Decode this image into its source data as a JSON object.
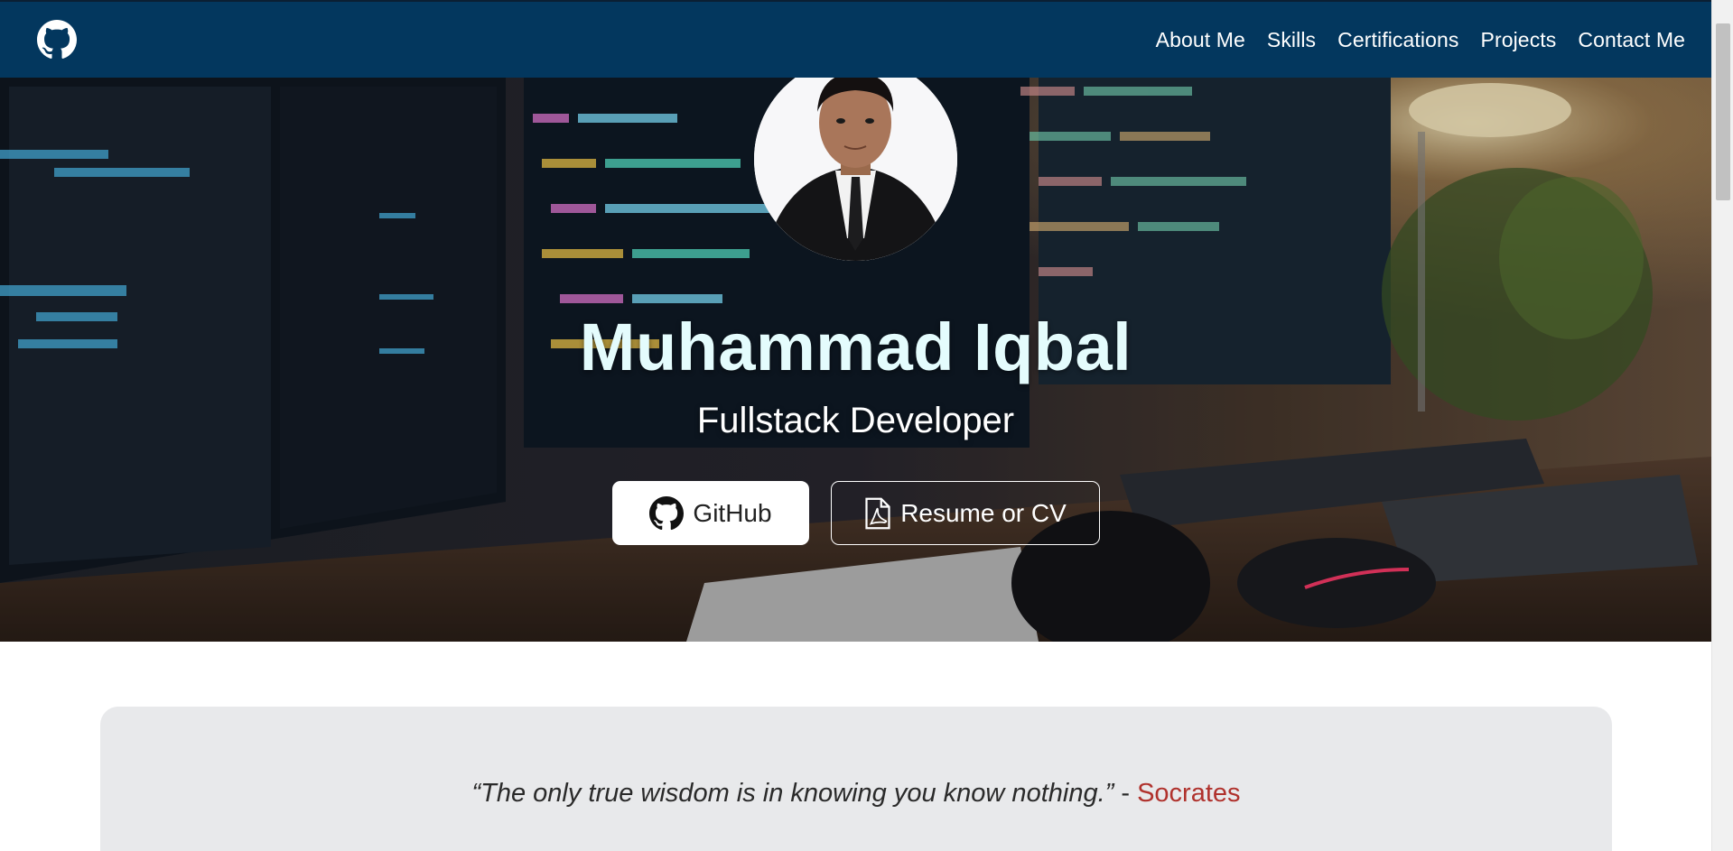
{
  "nav": {
    "logo_icon": "github-icon",
    "links": [
      "About Me",
      "Skills",
      "Certifications",
      "Projects",
      "Contact Me"
    ],
    "background": "#03375e"
  },
  "hero": {
    "name": "Muhammad Iqbal",
    "role": "Fullstack Developer",
    "github_button": "GitHub",
    "resume_button": "Resume or CV",
    "github_icon": "github-icon",
    "resume_icon": "pdf-file-icon"
  },
  "quote": {
    "text": "“The only true wisdom is in knowing you know nothing.”",
    "separator": " - ",
    "author": "Socrates",
    "author_color": "#b0322d"
  }
}
